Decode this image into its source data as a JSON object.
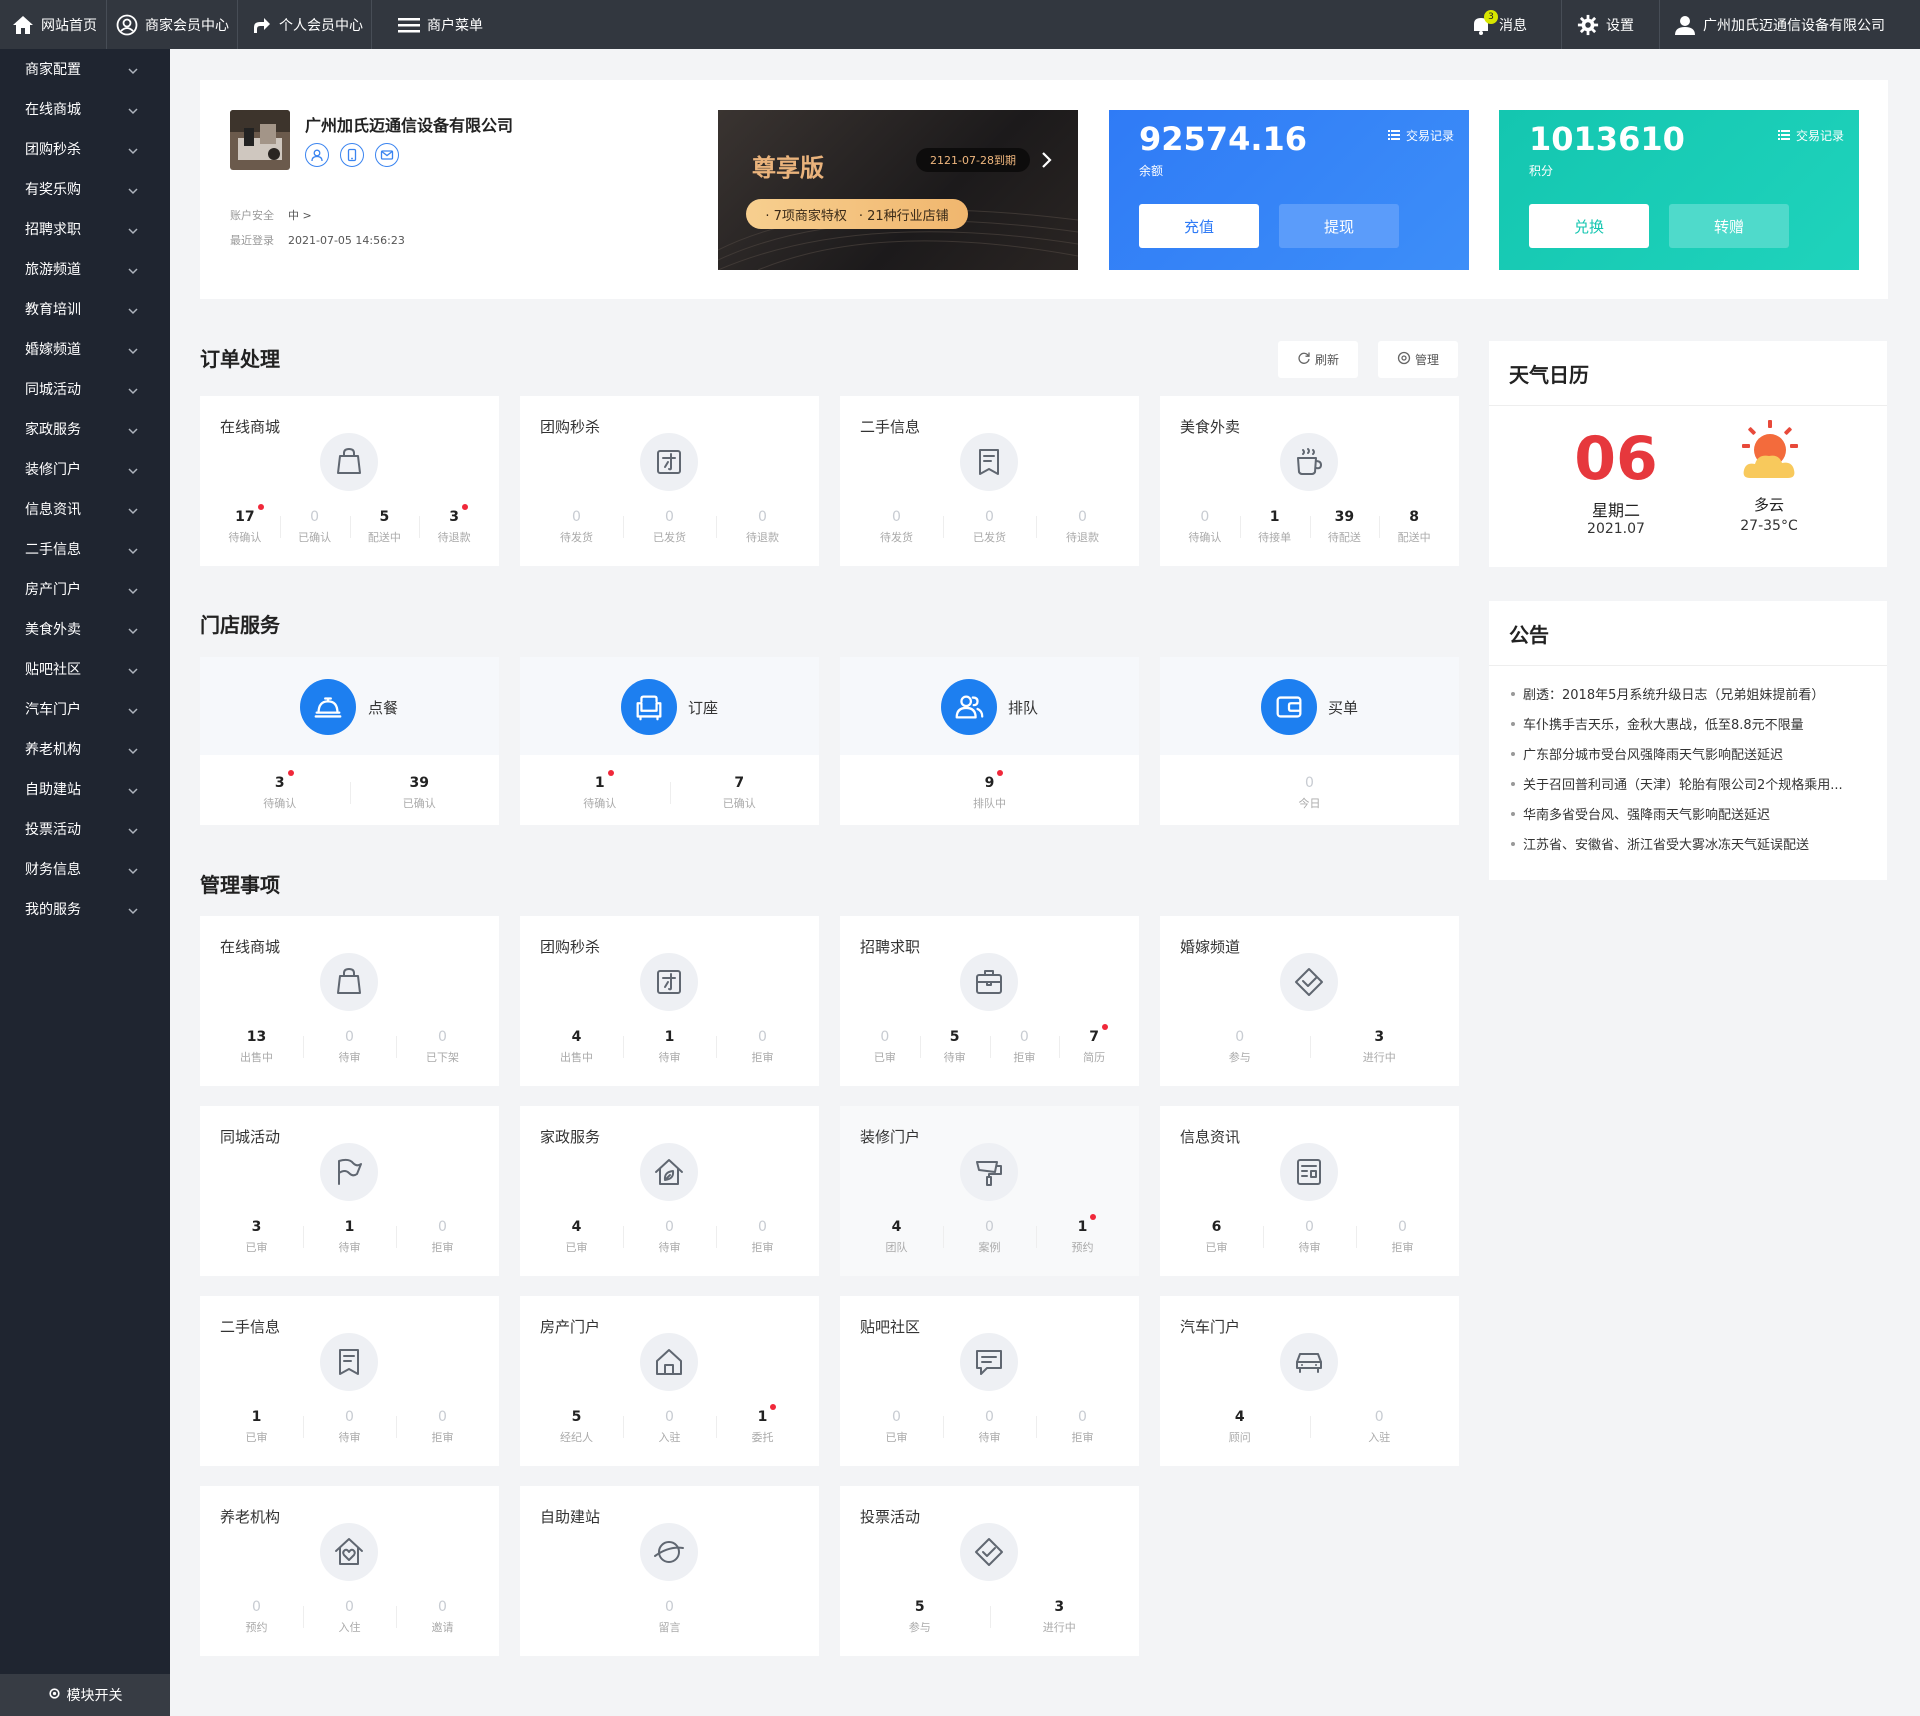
{
  "topbar": {
    "home": "网站首页",
    "merchant_center": "商家会员中心",
    "personal_center": "个人会员中心",
    "merchant_menu": "商户菜单",
    "messages": "消息",
    "message_count": "3",
    "settings": "设置",
    "user": "广州加氏迈通信设备有限公司"
  },
  "sidebar": {
    "items": [
      "商家配置",
      "在线商城",
      "团购秒杀",
      "有奖乐购",
      "招聘求职",
      "旅游频道",
      "教育培训",
      "婚嫁频道",
      "同城活动",
      "家政服务",
      "装修门户",
      "信息资讯",
      "二手信息",
      "房产门户",
      "美食外卖",
      "贴吧社区",
      "汽车门户",
      "养老机构",
      "自助建站",
      "投票活动",
      "财务信息",
      "我的服务"
    ],
    "module_toggle": "模块开关"
  },
  "profile": {
    "company": "广州加氏迈通信设备有限公司",
    "security_label": "账户安全",
    "security_value": "中 >",
    "last_login_label": "最近登录",
    "last_login_value": "2021-07-05 14:56:23",
    "vip": {
      "title": "尊享版",
      "expire": "2121-07-28到期",
      "perk1": "· 7项商家特权",
      "perk2": "· 21种行业店铺"
    },
    "balance": {
      "value": "92574.16",
      "label": "余额",
      "link": "交易记录",
      "btn1": "充值",
      "btn2": "提现"
    },
    "points": {
      "value": "1013610",
      "label": "积分",
      "link": "交易记录",
      "btn1": "兑换",
      "btn2": "转赠"
    }
  },
  "orders": {
    "title": "订单处理",
    "refresh": "刷新",
    "manage": "管理",
    "cards": [
      {
        "title": "在线商城",
        "icon": "bag-icon",
        "stats": [
          {
            "v": "17",
            "l": "待确认",
            "dot": true
          },
          {
            "v": "0",
            "l": "已确认"
          },
          {
            "v": "5",
            "l": "配送中"
          },
          {
            "v": "3",
            "l": "待退款",
            "dot": true
          }
        ]
      },
      {
        "title": "团购秒杀",
        "icon": "group-buy-icon",
        "stats": [
          {
            "v": "0",
            "l": "待发货"
          },
          {
            "v": "0",
            "l": "已发货"
          },
          {
            "v": "0",
            "l": "待退款"
          }
        ]
      },
      {
        "title": "二手信息",
        "icon": "secondhand-icon",
        "stats": [
          {
            "v": "0",
            "l": "待发货"
          },
          {
            "v": "0",
            "l": "已发货"
          },
          {
            "v": "0",
            "l": "待退款"
          }
        ]
      },
      {
        "title": "美食外卖",
        "icon": "coffee-cup-icon",
        "stats": [
          {
            "v": "0",
            "l": "待确认"
          },
          {
            "v": "1",
            "l": "待接单"
          },
          {
            "v": "39",
            "l": "待配送"
          },
          {
            "v": "8",
            "l": "配送中"
          }
        ]
      }
    ]
  },
  "store": {
    "title": "门店服务",
    "cards": [
      {
        "label": "点餐",
        "icon": "food-cloche-icon",
        "stats": [
          {
            "v": "3",
            "l": "待确认",
            "dot": true
          },
          {
            "v": "39",
            "l": "已确认"
          }
        ]
      },
      {
        "label": "订座",
        "icon": "sofa-icon",
        "stats": [
          {
            "v": "1",
            "l": "待确认",
            "dot": true
          },
          {
            "v": "7",
            "l": "已确认"
          }
        ]
      },
      {
        "label": "排队",
        "icon": "users-icon",
        "stats": [
          {
            "v": "9",
            "l": "排队中",
            "dot": true
          }
        ]
      },
      {
        "label": "买单",
        "icon": "wallet-icon",
        "stats": [
          {
            "v": "0",
            "l": "今日"
          }
        ]
      }
    ]
  },
  "manage": {
    "title": "管理事项",
    "cards": [
      {
        "title": "在线商城",
        "icon": "bag-icon",
        "stats": [
          {
            "v": "13",
            "l": "出售中"
          },
          {
            "v": "0",
            "l": "待审"
          },
          {
            "v": "0",
            "l": "已下架"
          }
        ]
      },
      {
        "title": "团购秒杀",
        "icon": "group-buy-icon",
        "stats": [
          {
            "v": "4",
            "l": "出售中"
          },
          {
            "v": "1",
            "l": "待审"
          },
          {
            "v": "0",
            "l": "拒审"
          }
        ]
      },
      {
        "title": "招聘求职",
        "icon": "briefcase-icon",
        "stats": [
          {
            "v": "0",
            "l": "已审"
          },
          {
            "v": "5",
            "l": "待审"
          },
          {
            "v": "0",
            "l": "拒审"
          },
          {
            "v": "7",
            "l": "简历",
            "dot": true
          }
        ]
      },
      {
        "title": "婚嫁频道",
        "icon": "diamond-icon",
        "stats": [
          {
            "v": "0",
            "l": "参与"
          },
          {
            "v": "3",
            "l": "进行中"
          }
        ]
      },
      {
        "title": "同城活动",
        "icon": "flag-icon",
        "stats": [
          {
            "v": "3",
            "l": "已审"
          },
          {
            "v": "1",
            "l": "待审"
          },
          {
            "v": "0",
            "l": "拒审"
          }
        ]
      },
      {
        "title": "家政服务",
        "icon": "house-leaf-icon",
        "stats": [
          {
            "v": "4",
            "l": "已审"
          },
          {
            "v": "0",
            "l": "待审"
          },
          {
            "v": "0",
            "l": "拒审"
          }
        ]
      },
      {
        "title": "装修门户",
        "icon": "paint-roller-icon",
        "hl": true,
        "stats": [
          {
            "v": "4",
            "l": "团队"
          },
          {
            "v": "0",
            "l": "案例"
          },
          {
            "v": "1",
            "l": "预约",
            "dot": true
          }
        ]
      },
      {
        "title": "信息资讯",
        "icon": "news-icon",
        "stats": [
          {
            "v": "6",
            "l": "已审"
          },
          {
            "v": "0",
            "l": "待审"
          },
          {
            "v": "0",
            "l": "拒审"
          }
        ]
      },
      {
        "title": "二手信息",
        "icon": "secondhand-icon",
        "stats": [
          {
            "v": "1",
            "l": "已审"
          },
          {
            "v": "0",
            "l": "待审"
          },
          {
            "v": "0",
            "l": "拒审"
          }
        ]
      },
      {
        "title": "房产门户",
        "icon": "house-icon",
        "stats": [
          {
            "v": "5",
            "l": "经纪人"
          },
          {
            "v": "0",
            "l": "入驻"
          },
          {
            "v": "1",
            "l": "委托",
            "dot": true
          }
        ]
      },
      {
        "title": "贴吧社区",
        "icon": "chat-icon",
        "stats": [
          {
            "v": "0",
            "l": "已审"
          },
          {
            "v": "0",
            "l": "待审"
          },
          {
            "v": "0",
            "l": "拒审"
          }
        ]
      },
      {
        "title": "汽车门户",
        "icon": "car-icon",
        "stats": [
          {
            "v": "4",
            "l": "顾问"
          },
          {
            "v": "0",
            "l": "入驻"
          }
        ]
      },
      {
        "title": "养老机构",
        "icon": "house-heart-icon",
        "stats": [
          {
            "v": "0",
            "l": "预约"
          },
          {
            "v": "0",
            "l": "入住"
          },
          {
            "v": "0",
            "l": "邀请"
          }
        ]
      },
      {
        "title": "自助建站",
        "icon": "planet-icon",
        "stats": [
          {
            "v": "0",
            "l": "留言"
          }
        ]
      },
      {
        "title": "投票活动",
        "icon": "vote-icon",
        "stats": [
          {
            "v": "5",
            "l": "参与"
          },
          {
            "v": "3",
            "l": "进行中"
          }
        ]
      }
    ]
  },
  "weather": {
    "title": "天气日历",
    "day": "06",
    "weekday": "星期二",
    "yearmonth": "2021.07",
    "condition": "多云",
    "temp": "27-35°C",
    "icon": "sun-cloud-icon"
  },
  "notice": {
    "title": "公告",
    "items": [
      "剧透：2018年5月系统升级日志（兄弟姐妹提前看）",
      "车仆携手吉天乐，金秋大惠战，低至8.8元不限量",
      "广东部分城市受台风强降雨天气影响配送延迟",
      "关于召回普利司通（天津）轮胎有限公司2个规格乘用...",
      "华南多省受台风、强降雨天气影响配送延迟",
      "江苏省、安徽省、浙江省受大雾冰冻天气延误配送"
    ]
  },
  "colors": {
    "topbar": "#32373f",
    "sidebar": "#1f2530",
    "accent_blue": "#2f7bf6",
    "accent_teal": "#14c6b0",
    "alert_red": "#e6383d",
    "vip_gold": "#eab37c"
  }
}
